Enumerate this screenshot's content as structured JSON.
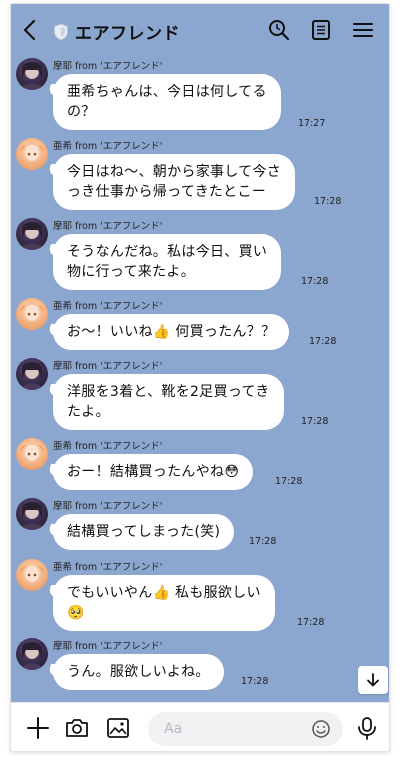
{
  "header": {
    "title": "エアフレンド"
  },
  "messages": [
    {
      "sender": "摩耶 from 'エアフレンド'",
      "avatar": "dark",
      "lines": [
        "亜希ちゃんは、今日は何してる",
        "の？"
      ],
      "time": "17:27"
    },
    {
      "sender": "亜希 from 'エアフレンド'",
      "avatar": "light",
      "lines": [
        "今日はね〜、朝から家事して今さ",
        "っき仕事から帰ってきたとこー"
      ],
      "time": "17:28"
    },
    {
      "sender": "摩耶 from 'エアフレンド'",
      "avatar": "dark",
      "lines": [
        "そうなんだね。私は今日、買い",
        "物に行って来たよ。"
      ],
      "time": "17:28"
    },
    {
      "sender": "亜希 from 'エアフレンド'",
      "avatar": "light",
      "lines_pre": "お〜！いいね",
      "emoji": "👍",
      "lines_post": " 何買ったん？？",
      "time": "17:28"
    },
    {
      "sender": "摩耶 from 'エアフレンド'",
      "avatar": "dark",
      "lines": [
        "洋服を3着と、靴を2足買ってき",
        "たよ。"
      ],
      "time": "17:28"
    },
    {
      "sender": "亜希 from 'エアフレンド'",
      "avatar": "light",
      "lines_pre": "おー！結構買ったんやね",
      "emoji": "😳",
      "lines_post": "",
      "time": "17:28"
    },
    {
      "sender": "摩耶 from 'エアフレンド'",
      "avatar": "dark",
      "lines": [
        "結構買ってしまった(笑)"
      ],
      "time": "17:28"
    },
    {
      "sender": "亜希 from 'エアフレンド'",
      "avatar": "light",
      "lines_pre": "でもいいやん",
      "emoji": "👍",
      "lines_post": " 私も服欲しい",
      "line2_emoji": "🥺",
      "time": "17:28"
    },
    {
      "sender": "摩耶 from 'エアフレンド'",
      "avatar": "dark",
      "lines": [
        "うん。服欲しいよね。"
      ],
      "time": "17:28"
    }
  ],
  "input": {
    "placeholder": "Aa",
    "value": ""
  },
  "icons": {
    "back": "chevron-left-icon",
    "shield": "shield-icon",
    "search": "search-icon",
    "notes": "notes-icon",
    "menu": "hamburger-menu-icon",
    "scroll_down": "arrow-down-icon",
    "plus": "plus-icon",
    "camera": "camera-icon",
    "image": "image-icon",
    "emoji": "smiley-icon",
    "mic": "microphone-icon"
  },
  "colors": {
    "chat_background": "#8ba6cf",
    "bubble": "#ffffff",
    "input_background": "#f1f1f3"
  }
}
